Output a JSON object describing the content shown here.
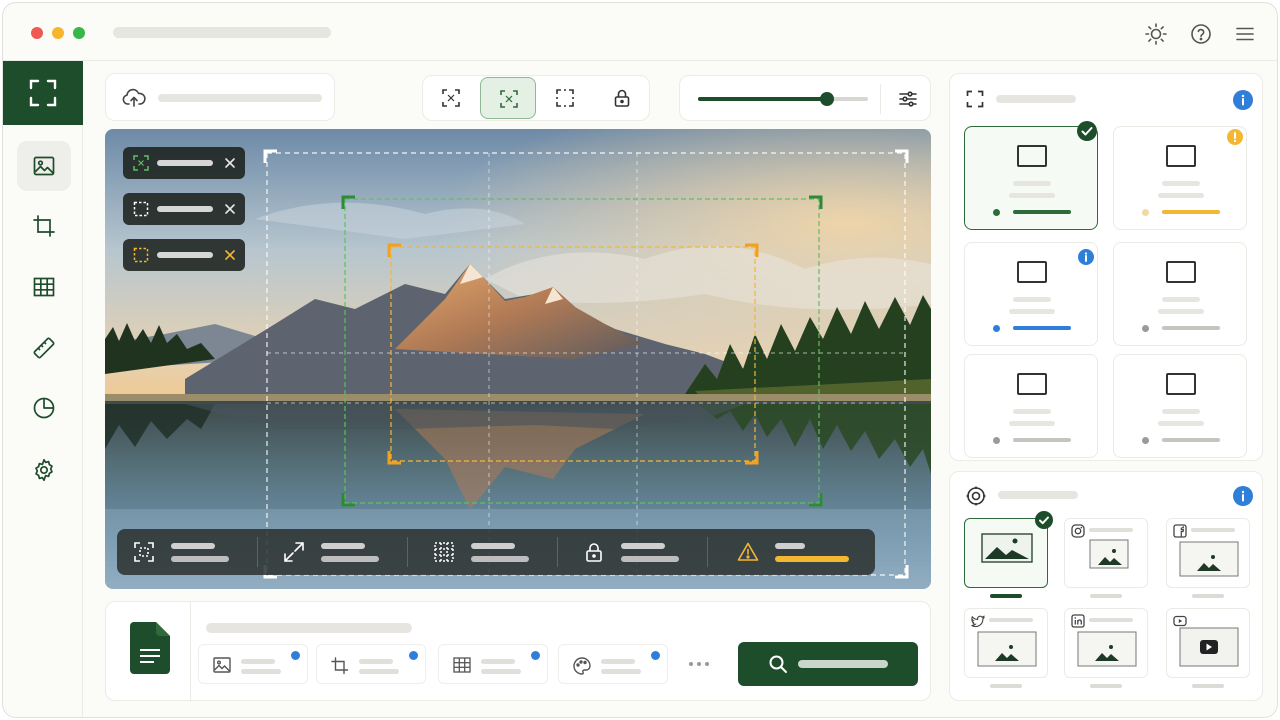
{
  "window": {
    "title": ""
  },
  "header_icons": [
    "sun-icon",
    "help-icon",
    "menu-icon"
  ],
  "rail": {
    "logo": "crop-frame-icon",
    "items": [
      "image-icon",
      "crop-icon",
      "grid-icon",
      "ruler-icon",
      "pie-chart-icon",
      "gear-icon"
    ],
    "active": 0
  },
  "toolbar": {
    "upload_icon": "cloud-upload-icon",
    "modes": [
      "focus-frame-icon",
      "smart-crop-icon",
      "free-crop-icon",
      "lock-icon"
    ],
    "active_mode": 1,
    "zoom_level": 0.76
  },
  "canvas": {
    "overlay_chips": [
      {
        "icon": "focus-frame-icon",
        "color": "#5fbf62"
      },
      {
        "icon": "free-crop-icon",
        "color": "#ffffff"
      },
      {
        "icon": "free-crop-icon",
        "color": "#f4b731"
      }
    ],
    "status_strip": [
      {
        "icon": "smart-crop-icon"
      },
      {
        "icon": "expand-icon"
      },
      {
        "icon": "grid-dots-icon"
      },
      {
        "icon": "lock-icon"
      },
      {
        "icon": "warning-icon",
        "color": "#f4b731"
      }
    ]
  },
  "presets": {
    "header_icon": "crop-frame-icon",
    "items": [
      {
        "status": "check",
        "color": "#2f6a3b",
        "selected": true
      },
      {
        "status": "warning",
        "color": "#f4b731",
        "selected": false
      },
      {
        "status": "info",
        "color": "#2f7fd9",
        "selected": false
      },
      {
        "status": "none",
        "color": "#9a9a9a",
        "selected": false
      },
      {
        "status": "none",
        "color": "#9a9a9a",
        "selected": false
      },
      {
        "status": "none",
        "color": "#9a9a9a",
        "selected": false
      }
    ]
  },
  "social": {
    "header_icon": "target-icon",
    "items": [
      "generic",
      "instagram-icon",
      "facebook-icon",
      "twitter-icon",
      "linkedin-icon",
      "youtube-icon"
    ],
    "selected": 0
  },
  "bottom_panel": {
    "file_icon": "document-icon",
    "tabs": [
      "image-icon",
      "crop-icon",
      "grid-icon",
      "palette-icon"
    ],
    "more_icon": "more-icon",
    "primary_icon": "search-icon"
  },
  "colors": {
    "brand": "#1e4d2b",
    "accent_green": "#2f6a3b",
    "warning": "#f4b731",
    "info": "#2f7fd9"
  }
}
